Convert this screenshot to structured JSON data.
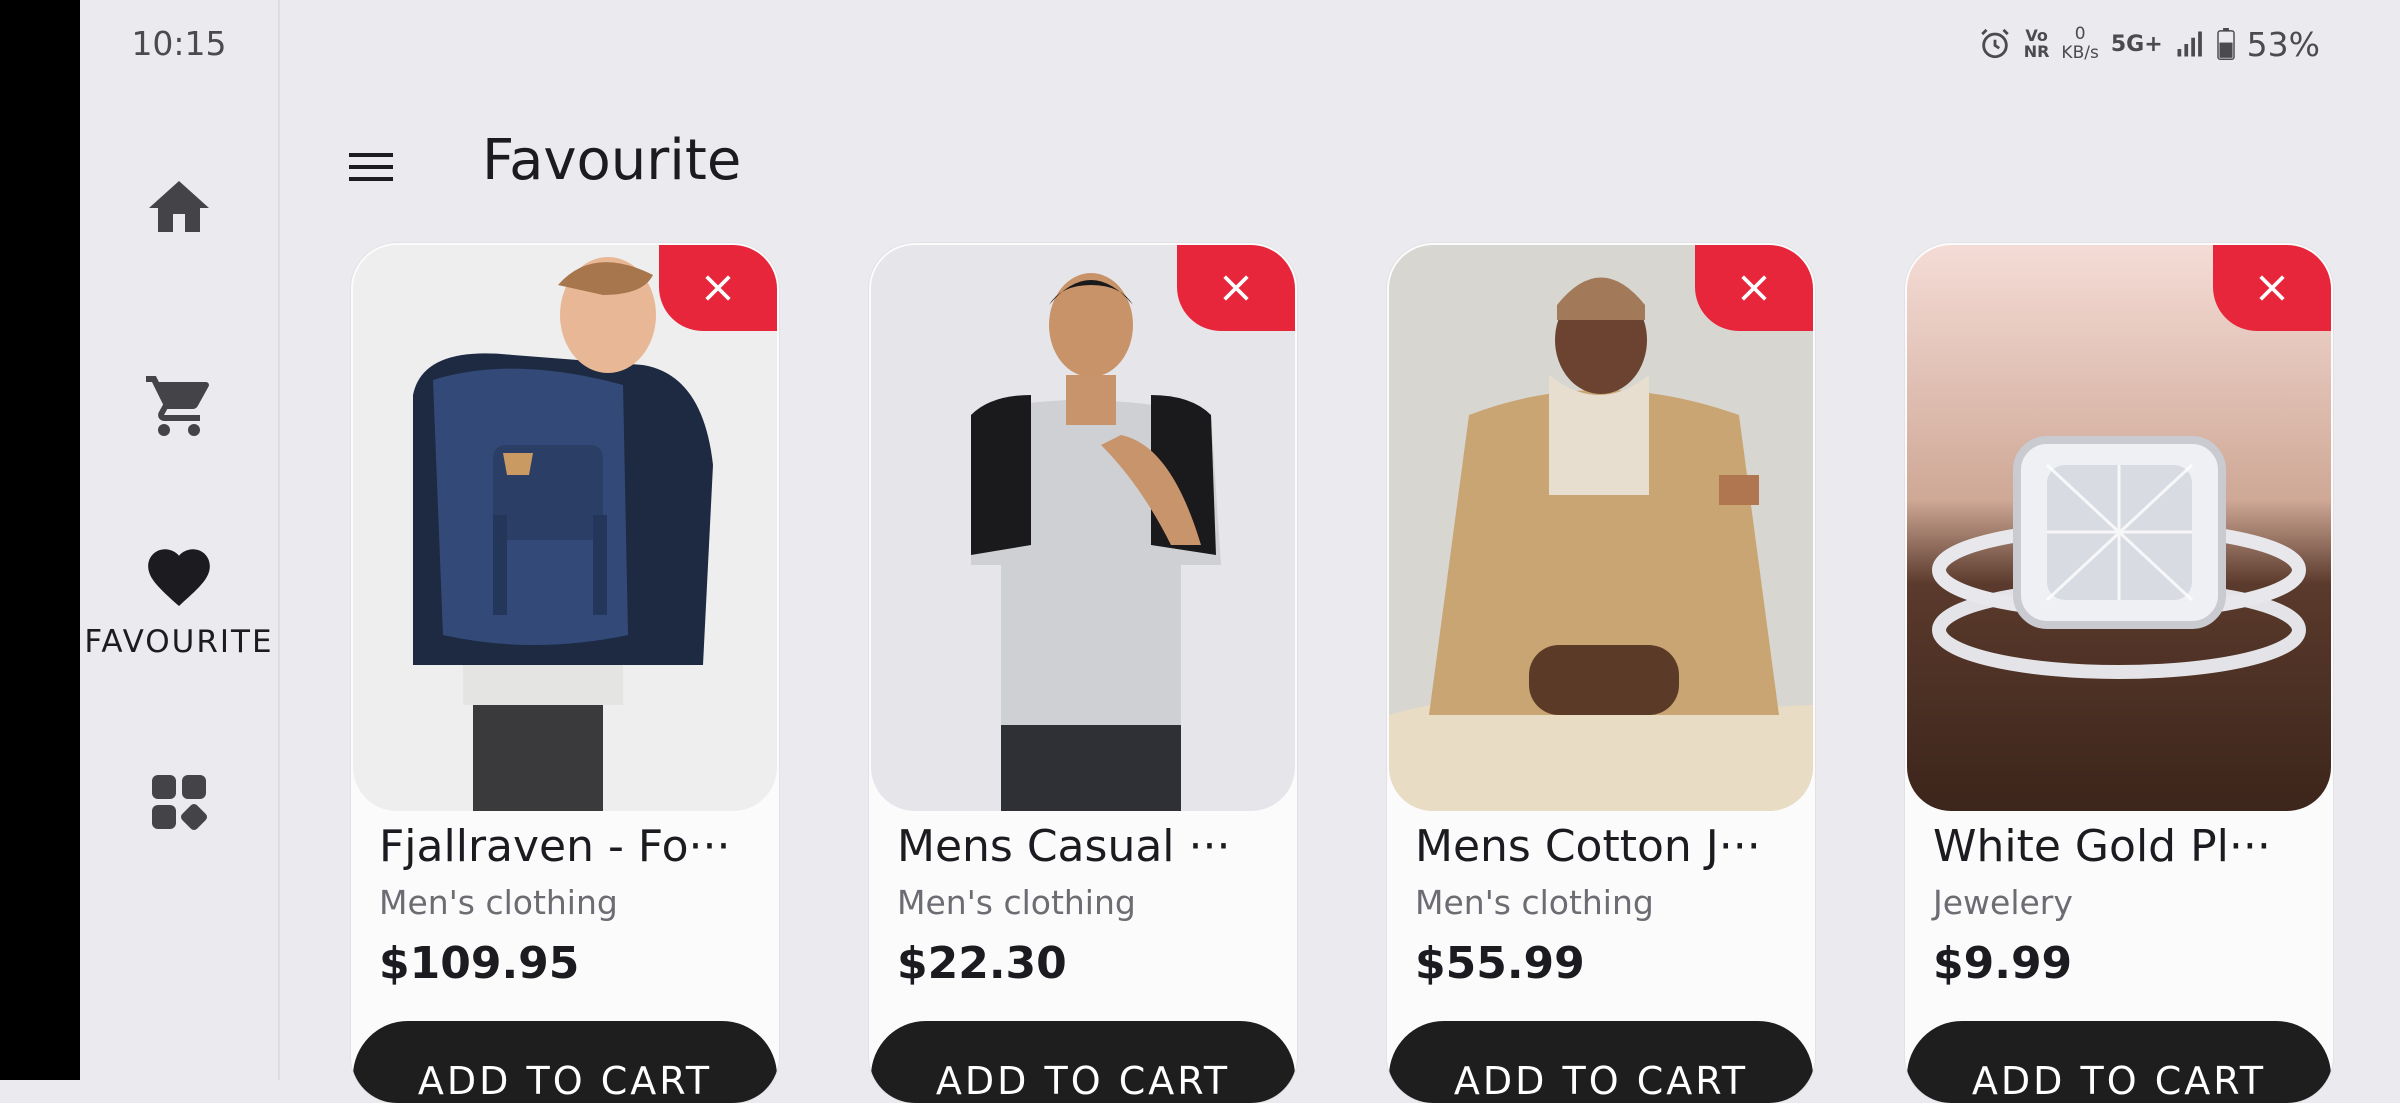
{
  "status_bar": {
    "time": "10:15",
    "volte_top": "Vo",
    "volte_bottom": "NR",
    "speed_value": "0",
    "speed_unit": "KB/s",
    "network": "5G+",
    "battery": "53%"
  },
  "nav_rail": {
    "items": [
      {
        "icon": "home-icon",
        "label": ""
      },
      {
        "icon": "cart-icon",
        "label": ""
      },
      {
        "icon": "heart-icon",
        "label": "FAVOURITE"
      },
      {
        "icon": "grid-icon",
        "label": ""
      }
    ]
  },
  "header": {
    "title": "Favourite",
    "menu_icon": "hamburger-icon"
  },
  "products": [
    {
      "title": "Fjallraven - Fo···",
      "category": "Men's clothing",
      "price": "$109.95",
      "button": "ADD TO CART"
    },
    {
      "title": "Mens Casual ···",
      "category": "Men's clothing",
      "price": "$22.30",
      "button": "ADD TO CART"
    },
    {
      "title": "Mens Cotton J···",
      "category": "Men's clothing",
      "price": "$55.99",
      "button": "ADD TO CART"
    },
    {
      "title": "White Gold Pl···",
      "category": "Jewelery",
      "price": "$9.99",
      "button": "ADD TO CART"
    }
  ],
  "colors": {
    "background": "#ebebef",
    "remove_button": "#e8263b",
    "cart_button": "#1e1e1f"
  }
}
